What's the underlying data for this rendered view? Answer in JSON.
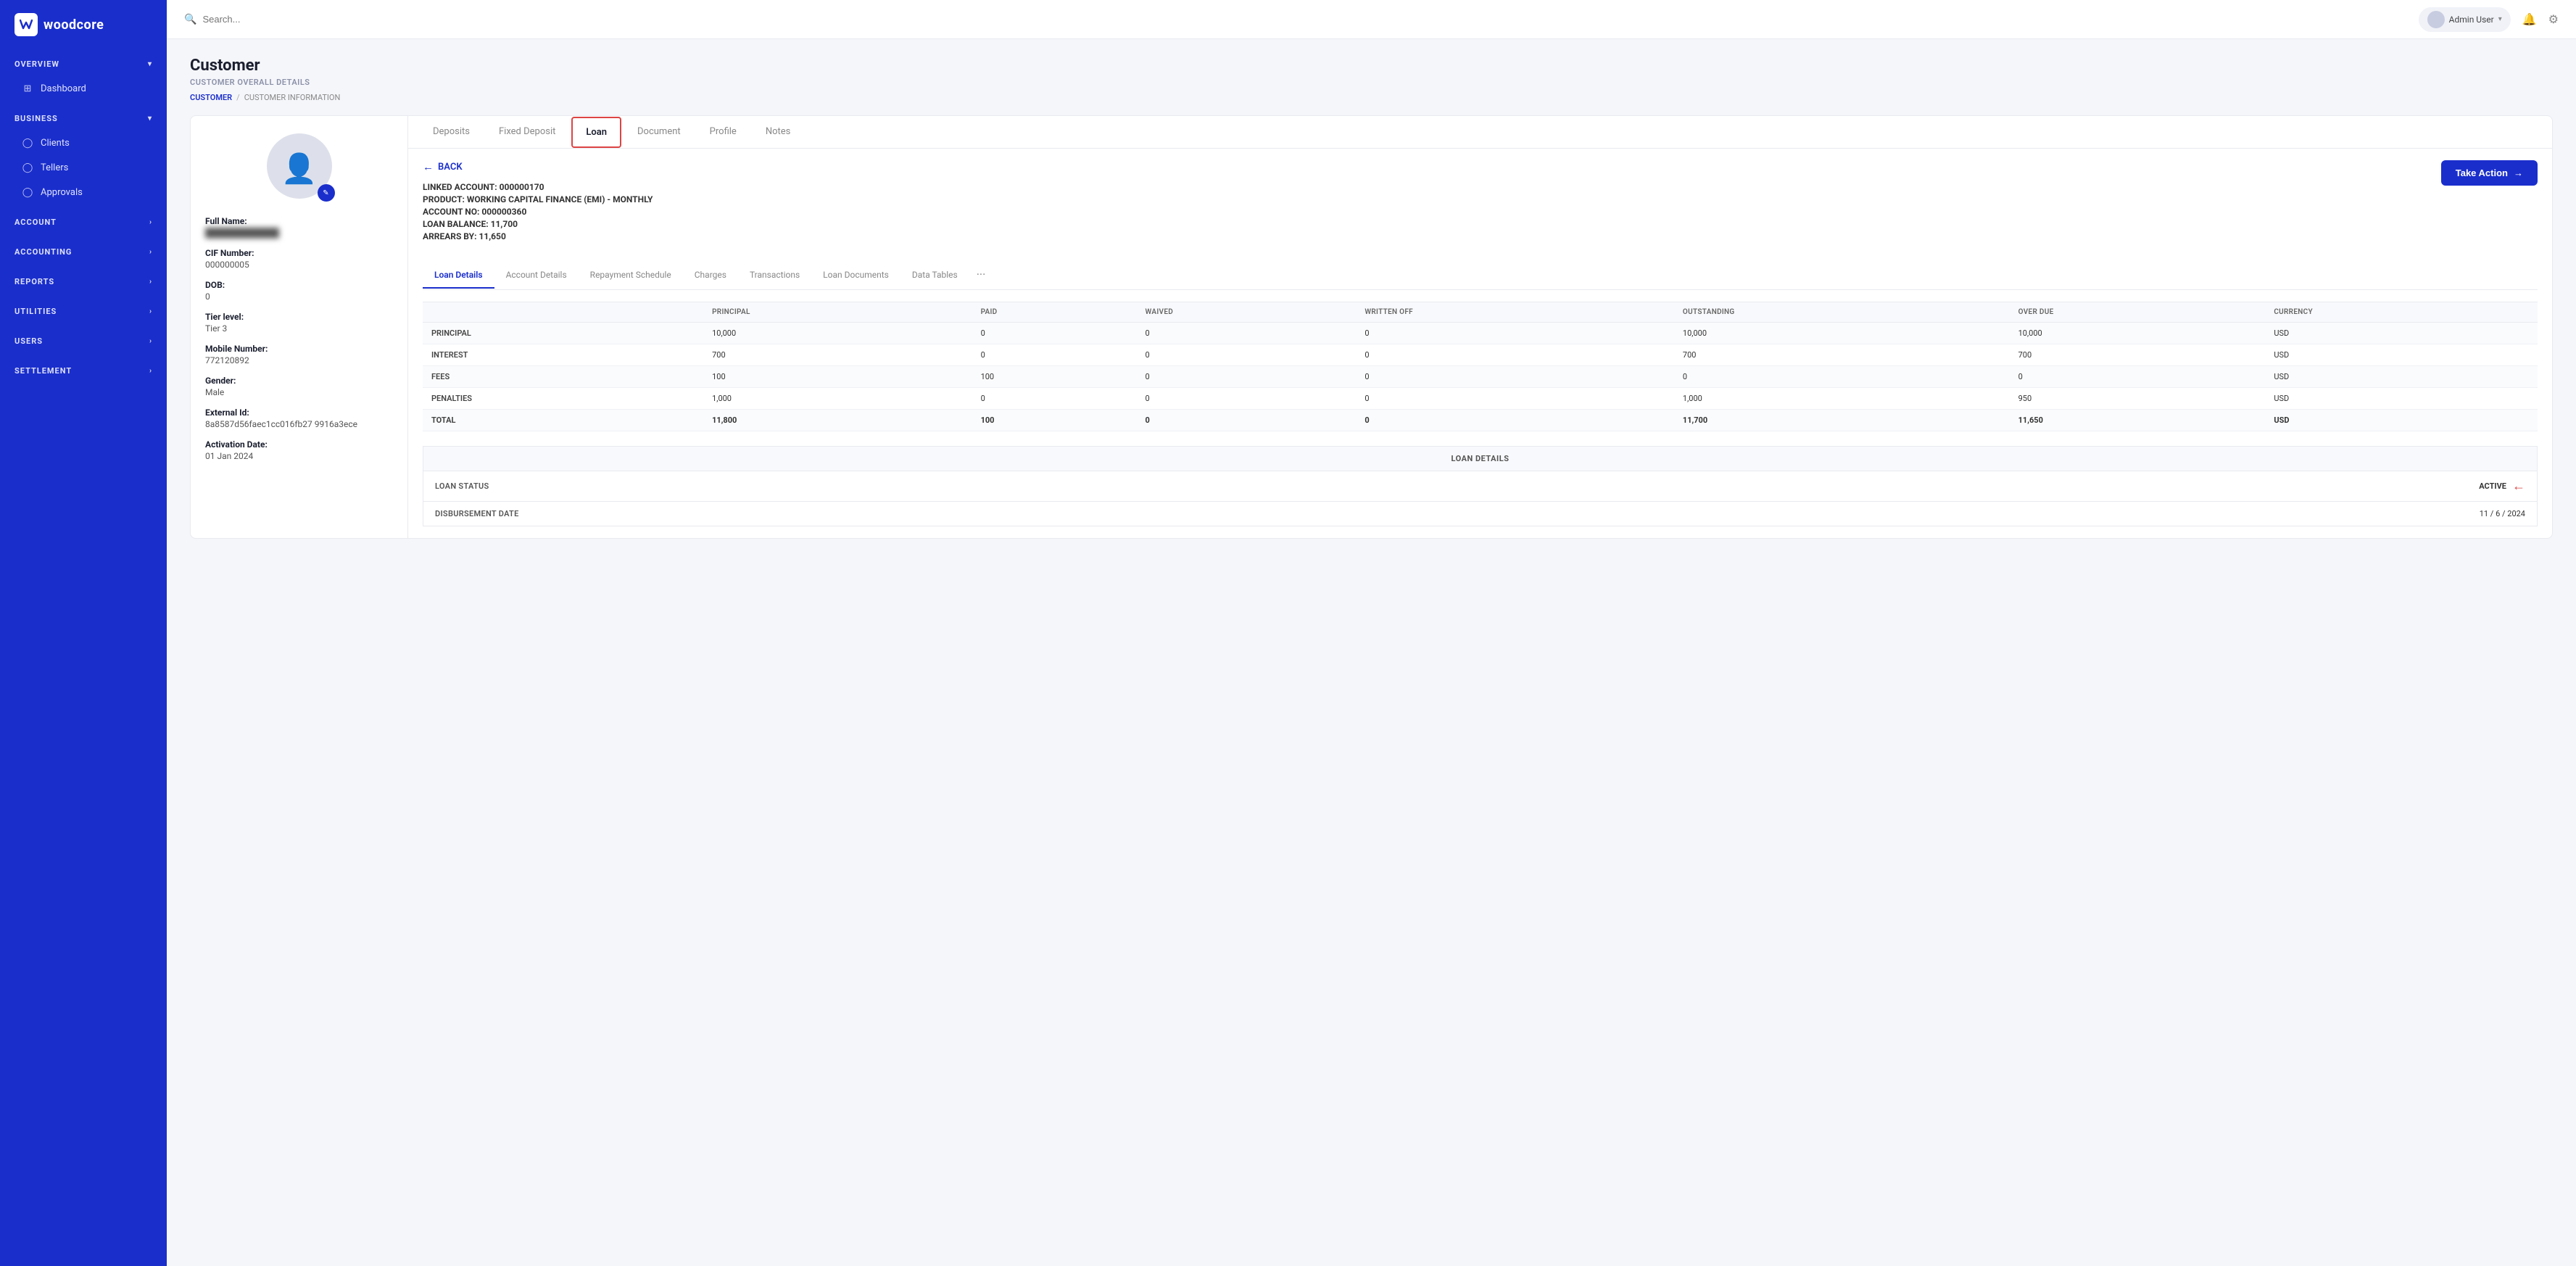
{
  "app": {
    "name": "woodcore",
    "logo_initial": "W"
  },
  "topbar": {
    "search_placeholder": "Search...",
    "user_name": "Admin User",
    "notification_label": "Notifications",
    "settings_label": "Settings"
  },
  "sidebar": {
    "sections": [
      {
        "id": "overview",
        "label": "OVERVIEW",
        "expanded": true,
        "items": [
          {
            "id": "dashboard",
            "label": "Dashboard",
            "icon": "grid"
          }
        ]
      },
      {
        "id": "business",
        "label": "BUSINESS",
        "expanded": true,
        "items": [
          {
            "id": "clients",
            "label": "Clients",
            "icon": "person"
          },
          {
            "id": "tellers",
            "label": "Tellers",
            "icon": "person"
          },
          {
            "id": "approvals",
            "label": "Approvals",
            "icon": "person"
          }
        ]
      },
      {
        "id": "account",
        "label": "ACCOUNT",
        "expanded": false,
        "items": []
      },
      {
        "id": "accounting",
        "label": "ACCOUNTING",
        "expanded": false,
        "items": []
      },
      {
        "id": "reports",
        "label": "REPORTS",
        "expanded": false,
        "items": []
      },
      {
        "id": "utilities",
        "label": "UTILITIES",
        "expanded": false,
        "items": []
      },
      {
        "id": "users",
        "label": "USERS",
        "expanded": false,
        "items": []
      },
      {
        "id": "settlement",
        "label": "SETTLEMENT",
        "expanded": false,
        "items": []
      }
    ]
  },
  "page": {
    "title": "Customer",
    "subtitle": "CUSTOMER OVERALL DETAILS",
    "breadcrumb_link": "CUSTOMER",
    "breadcrumb_separator": "/",
    "breadcrumb_current": "CUSTOMER INFORMATION"
  },
  "customer": {
    "full_name_label": "Full Name:",
    "full_name_value": "████████████",
    "cif_label": "CIF Number:",
    "cif_value": "000000005",
    "dob_label": "DOB:",
    "dob_value": "0",
    "tier_label": "Tier level:",
    "tier_value": "Tier 3",
    "mobile_label": "Mobile Number:",
    "mobile_value": "772120892",
    "gender_label": "Gender:",
    "gender_value": "Male",
    "external_id_label": "External Id:",
    "external_id_value": "8a8587d56faec1cc016fb27\n9916a3ece",
    "activation_label": "Activation Date:",
    "activation_value": "01 Jan 2024"
  },
  "tabs": [
    {
      "id": "deposits",
      "label": "Deposits",
      "active": false
    },
    {
      "id": "fixed_deposit",
      "label": "Fixed Deposit",
      "active": false
    },
    {
      "id": "loan",
      "label": "Loan",
      "active": true
    },
    {
      "id": "document",
      "label": "Document",
      "active": false
    },
    {
      "id": "profile",
      "label": "Profile",
      "active": false
    },
    {
      "id": "notes",
      "label": "Notes",
      "active": false
    }
  ],
  "loan": {
    "back_label": "BACK",
    "linked_account_label": "LINKED ACCOUNT:",
    "linked_account_value": "000000170",
    "product_label": "PRODUCT:",
    "product_value": "WORKING CAPITAL FINANCE (EMI) - MONTHLY",
    "account_no_label": "ACCOUNT NO:",
    "account_no_value": "000000360",
    "balance_label": "LOAN BALANCE:",
    "balance_value": "11,700",
    "arrears_label": "ARREARS BY:",
    "arrears_value": "11,650",
    "take_action_label": "Take Action",
    "sub_tabs": [
      {
        "id": "loan_details",
        "label": "Loan Details",
        "active": true
      },
      {
        "id": "account_details",
        "label": "Account Details",
        "active": false
      },
      {
        "id": "repayment_schedule",
        "label": "Repayment Schedule",
        "active": false
      },
      {
        "id": "charges",
        "label": "Charges",
        "active": false
      },
      {
        "id": "transactions",
        "label": "Transactions",
        "active": false
      },
      {
        "id": "loan_documents",
        "label": "Loan Documents",
        "active": false
      },
      {
        "id": "data_tables",
        "label": "Data Tables",
        "active": false
      }
    ],
    "table": {
      "headers": [
        "",
        "PRINCIPAL",
        "PAID",
        "WAIVED",
        "WRITTEN OFF",
        "OUTSTANDING",
        "OVER DUE",
        "CURRENCY"
      ],
      "rows": [
        {
          "type": "PRINCIPAL",
          "principal": "10,000",
          "paid": "0",
          "waived": "0",
          "written_off": "0",
          "outstanding": "10,000",
          "over_due": "10,000",
          "currency": "USD"
        },
        {
          "type": "INTEREST",
          "principal": "700",
          "paid": "0",
          "waived": "0",
          "written_off": "0",
          "outstanding": "700",
          "over_due": "700",
          "currency": "USD"
        },
        {
          "type": "FEES",
          "principal": "100",
          "paid": "100",
          "waived": "0",
          "written_off": "0",
          "outstanding": "0",
          "over_due": "0",
          "currency": "USD"
        },
        {
          "type": "PENALTIES",
          "principal": "1,000",
          "paid": "0",
          "waived": "0",
          "written_off": "0",
          "outstanding": "1,000",
          "over_due": "950",
          "currency": "USD"
        },
        {
          "type": "TOTAL",
          "principal": "11,800",
          "paid": "100",
          "waived": "0",
          "written_off": "0",
          "outstanding": "11,700",
          "over_due": "11,650",
          "currency": "USD"
        }
      ]
    },
    "details_section": {
      "header": "LOAN DETAILS",
      "status_label": "LOAN STATUS",
      "status_value": "ACTIVE",
      "disbursement_label": "DISBURSEMENT DATE",
      "disbursement_value": "11 / 6 / 2024"
    }
  }
}
